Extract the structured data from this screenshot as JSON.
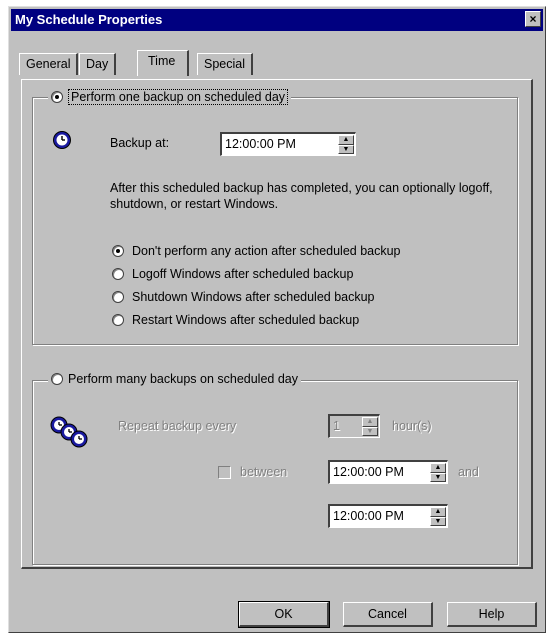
{
  "window": {
    "title": "My Schedule Properties",
    "close_glyph": "×"
  },
  "tabs": [
    {
      "label": "General",
      "active": false
    },
    {
      "label": "Day",
      "active": false
    },
    {
      "label": "Time",
      "active": true
    },
    {
      "label": "Special",
      "active": false
    }
  ],
  "one_backup": {
    "radio_label": "Perform one backup on scheduled day",
    "selected": true,
    "icon": "clock-icon",
    "backup_at_label": "Backup at:",
    "backup_at_value": "12:00:00 PM",
    "description": "After this scheduled backup has completed, you can optionally logoff, shutdown, or restart Windows.",
    "actions": [
      {
        "label": "Don't perform any action after scheduled backup",
        "selected": true
      },
      {
        "label": "Logoff Windows after scheduled backup",
        "selected": false
      },
      {
        "label": "Shutdown Windows after scheduled backup",
        "selected": false
      },
      {
        "label": "Restart Windows after scheduled backup",
        "selected": false
      }
    ]
  },
  "many_backups": {
    "radio_label": "Perform many backups on scheduled day",
    "selected": false,
    "icon": "multiple-clocks-icon",
    "repeat_label": "Repeat backup every",
    "repeat_value": "1",
    "repeat_unit": "hour(s)",
    "between_label": "between",
    "between_checked": false,
    "start_time": "12:00:00 PM",
    "and_label": "and",
    "end_time": "12:00:00 PM"
  },
  "buttons": {
    "ok": "OK",
    "cancel": "Cancel",
    "help": "Help"
  },
  "colors": {
    "titlebar": "#000080",
    "face": "#c0c0c0",
    "icon_blue": "#1a1aa0"
  }
}
